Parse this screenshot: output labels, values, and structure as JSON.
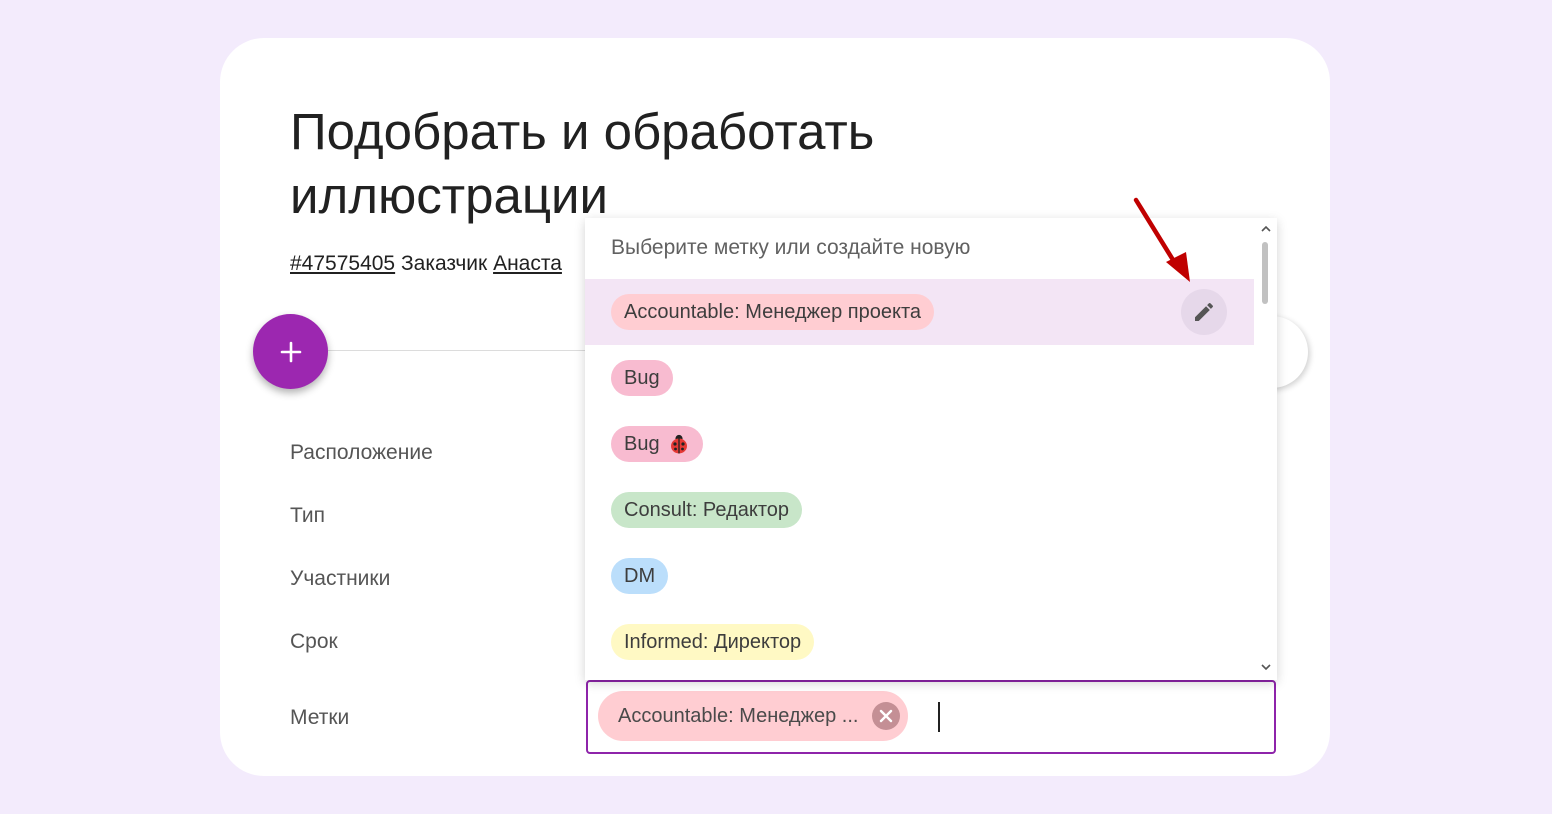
{
  "task": {
    "title": "Подобрать и обработать иллюстрации",
    "id_link": "#47575405",
    "customer_label": "Заказчик",
    "customer_name": "Анаста"
  },
  "fields": {
    "location": "Расположение",
    "type": "Тип",
    "participants": "Участники",
    "deadline": "Срок",
    "tags": "Метки"
  },
  "tags_input": {
    "selected_chip": "Accountable: Менеджер ...",
    "selected_chip_color": "#ffcdd2"
  },
  "dropdown": {
    "header": "Выберите метку или создайте новую",
    "options": [
      {
        "label": "Accountable: Менеджер проекта",
        "color": "#ffcdd2",
        "active": true
      },
      {
        "label": "Bug",
        "color": "#f8bbd0"
      },
      {
        "label": "Bug",
        "color": "#f8bbd0",
        "icon": "ladybug-icon"
      },
      {
        "label": "Consult: Редактор",
        "color": "#c8e6c9"
      },
      {
        "label": "DM",
        "color": "#bbdefb"
      },
      {
        "label": "Informed: Директор",
        "color": "#fff9c4"
      }
    ]
  },
  "colors": {
    "accent": "#9c27b0",
    "page_background": "#f3ebfc",
    "annotation_arrow": "#c00000"
  }
}
